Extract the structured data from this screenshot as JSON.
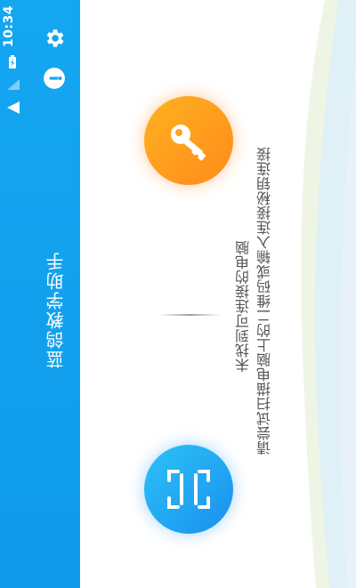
{
  "status_bar": {
    "time": "10:34"
  },
  "app_bar": {
    "title": "蓝鸽教学助手"
  },
  "main": {
    "message_line1": "未找到可连接的电脑",
    "message_line2": "请尝试扫描电脑上的二维码或输入连接秘钥连接"
  },
  "colors": {
    "app_bar": "#14a6f0",
    "key_button": "#ff9f1d",
    "scan_button": "#22a7f2",
    "text": "#555555"
  },
  "icons": {
    "settings": "gear-icon",
    "info": "info-icon",
    "key": "key-icon",
    "scan": "scan-icon",
    "battery": "battery-charging-icon",
    "signal": "signal-icon",
    "wifi": "wifi-icon"
  }
}
